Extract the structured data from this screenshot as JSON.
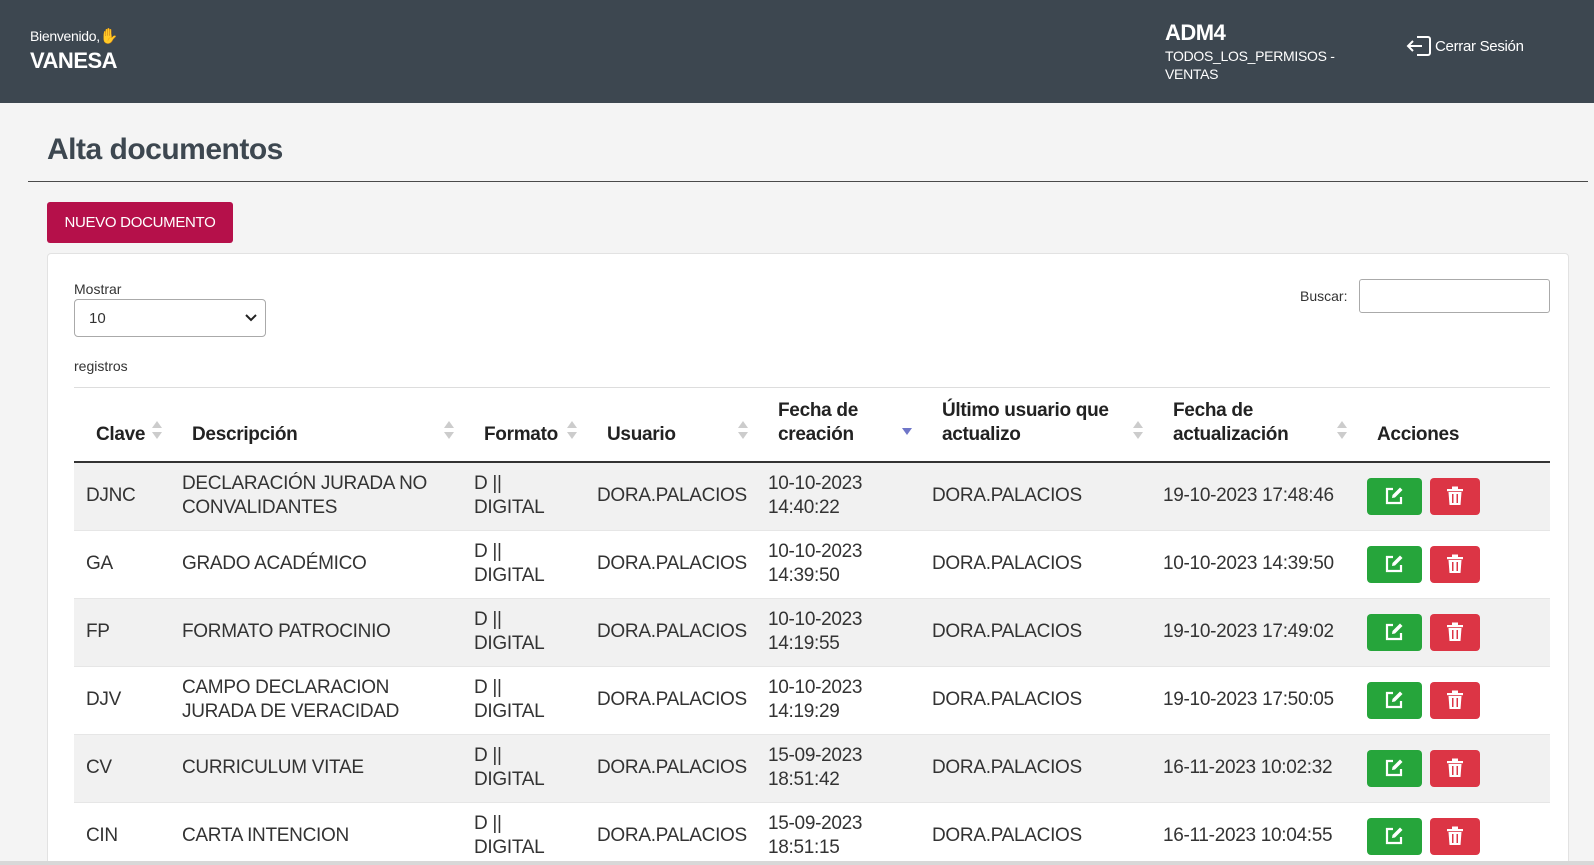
{
  "header": {
    "welcome": "Bienvenido,",
    "username": "VANESA",
    "role_code": "ADM4",
    "role_name": "TODOS_LOS_PERMISOS - VENTAS",
    "logout_label": "Cerrar Sesión",
    "background": "#3d4750"
  },
  "page": {
    "title": "Alta documentos",
    "new_button": "NUEVO DOCUMENTO",
    "accent": "#b5104a"
  },
  "controls": {
    "show_label": "Mostrar",
    "page_length": "10",
    "records_label": "registros",
    "search_label": "Buscar:",
    "search_value": ""
  },
  "table": {
    "columns": [
      "Clave",
      "Descripción",
      "Formato",
      "Usuario",
      "Fecha de creación",
      "Último usuario que actualizo",
      "Fecha de actualización",
      "Acciones"
    ],
    "sorted_column": "Fecha de creación",
    "sort_direction": "desc",
    "rows": [
      {
        "clave": "DJNC",
        "descripcion": "DECLARACIÓN JURADA NO CONVALIDANTES",
        "formato": "D || DIGITAL",
        "usuario": "DORA.PALACIOS",
        "creacion": "10-10-2023 14:40:22",
        "ultimo_usuario": "DORA.PALACIOS",
        "actualizacion": "19-10-2023 17:48:46"
      },
      {
        "clave": "GA",
        "descripcion": "GRADO ACADÉMICO",
        "formato": "D || DIGITAL",
        "usuario": "DORA.PALACIOS",
        "creacion": "10-10-2023 14:39:50",
        "ultimo_usuario": "DORA.PALACIOS",
        "actualizacion": "10-10-2023 14:39:50"
      },
      {
        "clave": "FP",
        "descripcion": "FORMATO PATROCINIO",
        "formato": "D || DIGITAL",
        "usuario": "DORA.PALACIOS",
        "creacion": "10-10-2023 14:19:55",
        "ultimo_usuario": "DORA.PALACIOS",
        "actualizacion": "19-10-2023 17:49:02"
      },
      {
        "clave": "DJV",
        "descripcion": "CAMPO DECLARACION JURADA DE VERACIDAD",
        "formato": "D || DIGITAL",
        "usuario": "DORA.PALACIOS",
        "creacion": "10-10-2023 14:19:29",
        "ultimo_usuario": "DORA.PALACIOS",
        "actualizacion": "19-10-2023 17:50:05"
      },
      {
        "clave": "CV",
        "descripcion": "CURRICULUM VITAE",
        "formato": "D || DIGITAL",
        "usuario": "DORA.PALACIOS",
        "creacion": "15-09-2023 18:51:42",
        "ultimo_usuario": "DORA.PALACIOS",
        "actualizacion": "16-11-2023 10:02:32"
      },
      {
        "clave": "CIN",
        "descripcion": "CARTA INTENCION",
        "formato": "D || DIGITAL",
        "usuario": "DORA.PALACIOS",
        "creacion": "15-09-2023 18:51:15",
        "ultimo_usuario": "DORA.PALACIOS",
        "actualizacion": "16-11-2023 10:04:55"
      }
    ],
    "action_icons": {
      "edit": "edit-icon",
      "delete": "trash-icon"
    },
    "colors": {
      "edit": "#26a53b",
      "delete": "#dc3545"
    }
  }
}
